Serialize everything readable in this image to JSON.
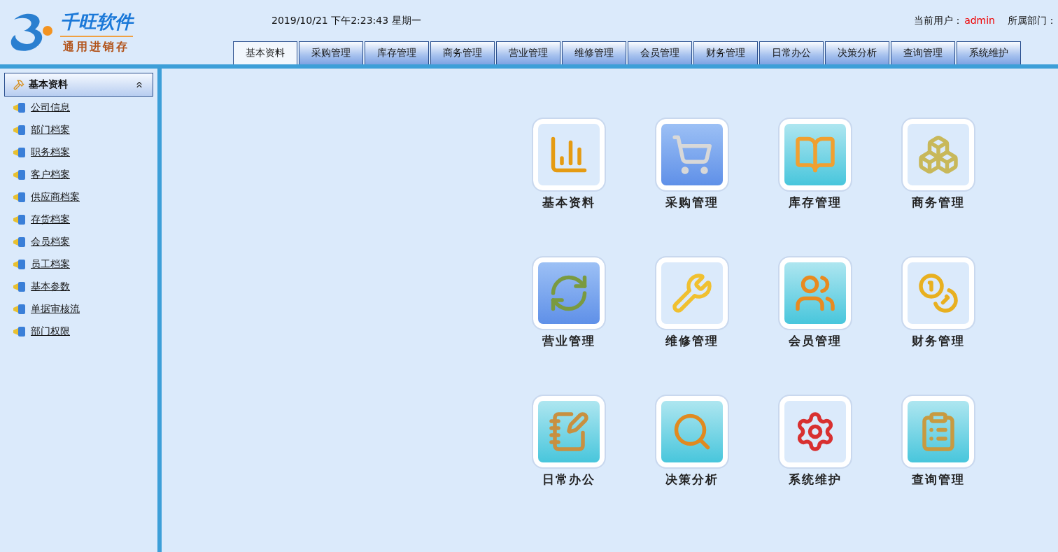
{
  "logo": {
    "name": "千旺软件",
    "subtitle": "通用进销存"
  },
  "header": {
    "datetime": "2019/10/21 下午2:23:43 星期一",
    "user_label": "当前用户：",
    "user": "admin",
    "dept_label": "所属部门："
  },
  "tabs": [
    {
      "label": "基本资料",
      "selected": true
    },
    {
      "label": "采购管理",
      "selected": false
    },
    {
      "label": "库存管理",
      "selected": false
    },
    {
      "label": "商务管理",
      "selected": false
    },
    {
      "label": "营业管理",
      "selected": false
    },
    {
      "label": "维修管理",
      "selected": false
    },
    {
      "label": "会员管理",
      "selected": false
    },
    {
      "label": "财务管理",
      "selected": false
    },
    {
      "label": "日常办公",
      "selected": false
    },
    {
      "label": "决策分析",
      "selected": false
    },
    {
      "label": "查询管理",
      "selected": false
    },
    {
      "label": "系统维护",
      "selected": false
    }
  ],
  "sidebar": {
    "title": "基本资料",
    "expanded": true,
    "items": [
      "公司信息",
      "部门档案",
      "职务档案",
      "客户档案",
      "供应商档案",
      "存货档案",
      "会员档案",
      "员工档案",
      "基本参数",
      "单据审核流",
      "部门权限"
    ]
  },
  "modules": [
    {
      "label": "基本资料"
    },
    {
      "label": "采购管理"
    },
    {
      "label": "库存管理"
    },
    {
      "label": "商务管理"
    },
    {
      "label": "营业管理"
    },
    {
      "label": "维修管理"
    },
    {
      "label": "会员管理"
    },
    {
      "label": "财务管理"
    },
    {
      "label": "日常办公"
    },
    {
      "label": "决策分析"
    },
    {
      "label": "系统维护"
    },
    {
      "label": "查询管理"
    }
  ]
}
